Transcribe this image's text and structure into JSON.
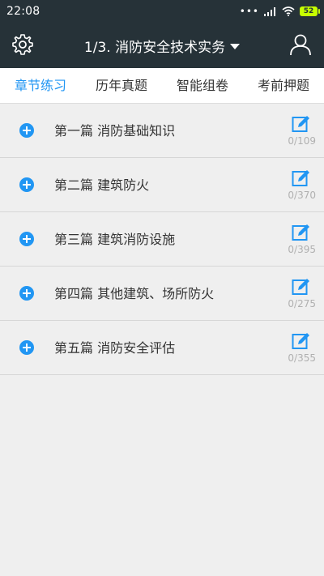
{
  "status_bar": {
    "time": "22:08",
    "signal_dots": "•••",
    "battery": "52"
  },
  "header": {
    "title": "1/3. 消防安全技术实务",
    "settings_icon": "gear-icon",
    "user_icon": "user-icon"
  },
  "tabs": [
    {
      "label": "章节练习",
      "active": true
    },
    {
      "label": "历年真题",
      "active": false
    },
    {
      "label": "智能组卷",
      "active": false
    },
    {
      "label": "考前押题",
      "active": false
    }
  ],
  "chapters": [
    {
      "label": "第一篇 消防基础知识",
      "progress": "0/109"
    },
    {
      "label": "第二篇 建筑防火",
      "progress": "0/370"
    },
    {
      "label": "第三篇 建筑消防设施",
      "progress": "0/395"
    },
    {
      "label": "第四篇 其他建筑、场所防火",
      "progress": "0/275"
    },
    {
      "label": "第五篇 消防安全评估",
      "progress": "0/355"
    }
  ],
  "colors": {
    "header_bg": "#263238",
    "accent": "#2196f3",
    "battery": "#c6ff00",
    "page_bg": "#efefef"
  }
}
